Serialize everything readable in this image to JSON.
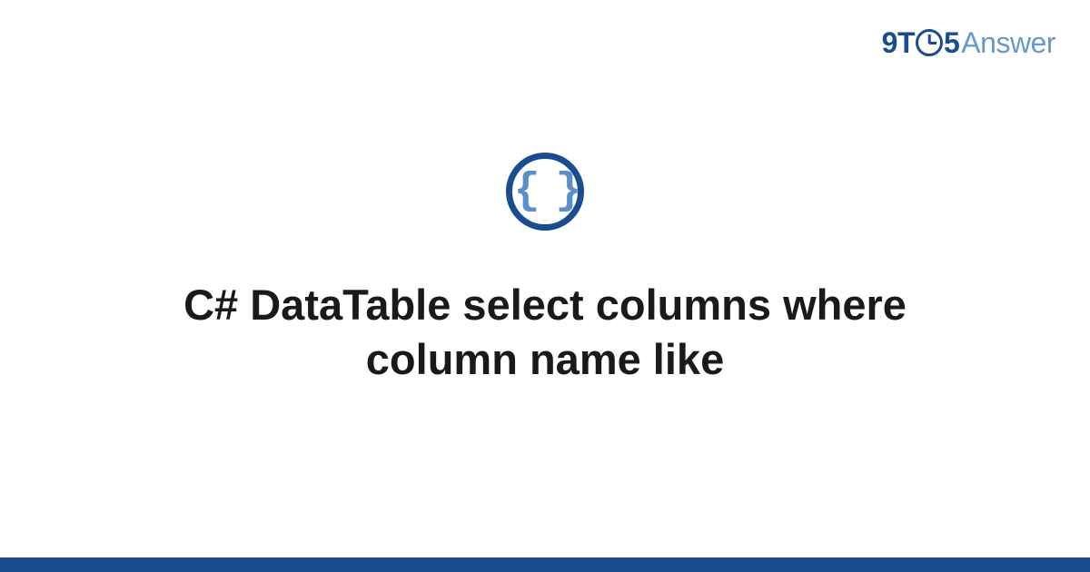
{
  "logo": {
    "part1": "9T",
    "part2": "5",
    "part3": "Answer"
  },
  "icon": {
    "name": "code-braces-icon",
    "glyph": "{ }"
  },
  "title": "C# DataTable select columns where column name like",
  "colors": {
    "primary": "#1a4d8f",
    "secondary": "#6699cc",
    "iconBrace": "#5a8fc7"
  }
}
